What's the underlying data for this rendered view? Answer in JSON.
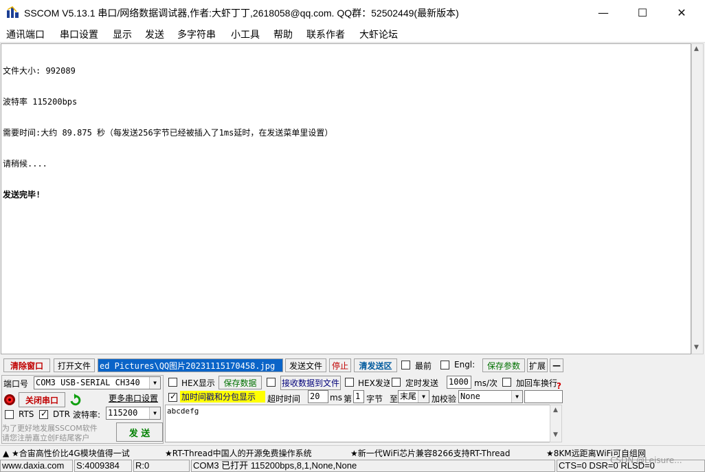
{
  "window": {
    "title": "SSCOM V5.13.1 串口/网络数据调试器,作者:大虾丁丁,2618058@qq.com. QQ群：52502449(最新版本)",
    "min": "—",
    "max": "☐",
    "close": "✕"
  },
  "menu": [
    "通讯端口",
    "串口设置",
    "显示",
    "发送",
    "多字符串",
    "小工具",
    "帮助",
    "联系作者",
    "大虾论坛"
  ],
  "receive": {
    "lines": [
      "文件大小: 992089",
      "波特率 115200bps",
      "需要时间:大约 89.875 秒（每发送256字节已经被插入了1ms延时，在发送菜单里设置）",
      "请稍候....",
      "发送完毕!"
    ]
  },
  "toolbar": {
    "clear": "清除窗口",
    "open_file": "打开文件",
    "file_path": "ed Pictures\\QQ图片20231115170458.jpg",
    "send_file": "发送文件",
    "stop": "停止",
    "clear_send": "清发送区",
    "topmost": "最前",
    "english": "Engl:",
    "save_params": "保存参数",
    "expand": "扩展",
    "collapse": "—"
  },
  "port": {
    "label": "端口号",
    "value": "COM3 USB-SERIAL CH340",
    "close_btn": "关闭串口",
    "more_settings": "更多串口设置",
    "rts": "RTS",
    "dtr": "DTR",
    "baud_label": "波特率:",
    "baud": "115200",
    "promo1": "为了更好地发展SSCOM软件",
    "promo2": "请您注册嘉立创F结尾客户",
    "send_btn": "发  送"
  },
  "options": {
    "hex_show": "HEX显示",
    "save_data": "保存数据",
    "recv_to_file": "接收数据到文件",
    "hex_send": "HEX发送",
    "timed_send": "定时发送",
    "interval": "1000",
    "interval_unit": "ms/次",
    "add_crlf": "加回车换行",
    "timestamp": "加时间戳和分包显示",
    "timeout_label": "超时时间",
    "timeout": "20",
    "ms": "ms",
    "byte_from_label": "第",
    "byte_from": "1",
    "byte_unit": "字节",
    "to_label": "至",
    "to_value": "末尾",
    "checksum_label": "加校验",
    "checksum": "None"
  },
  "send": {
    "text": "abcdefg"
  },
  "ticker": [
    "▲ ★合宙高性价比4G模块值得一试",
    "★RT-Thread中国人的开源免费操作系统",
    "★新一代WiFi芯片兼容8266支持RT-Thread",
    "★8KM远距离WiFi可自组网"
  ],
  "status": {
    "site": "www.daxia.com",
    "sent": "S:4009384",
    "recv": "R:0",
    "port_info": "COM3 已打开  115200bps,8,1,None,None",
    "lines": "CTS=0 DSR=0 RLSD=0",
    "watermark": "CSDN @Leisure..."
  }
}
